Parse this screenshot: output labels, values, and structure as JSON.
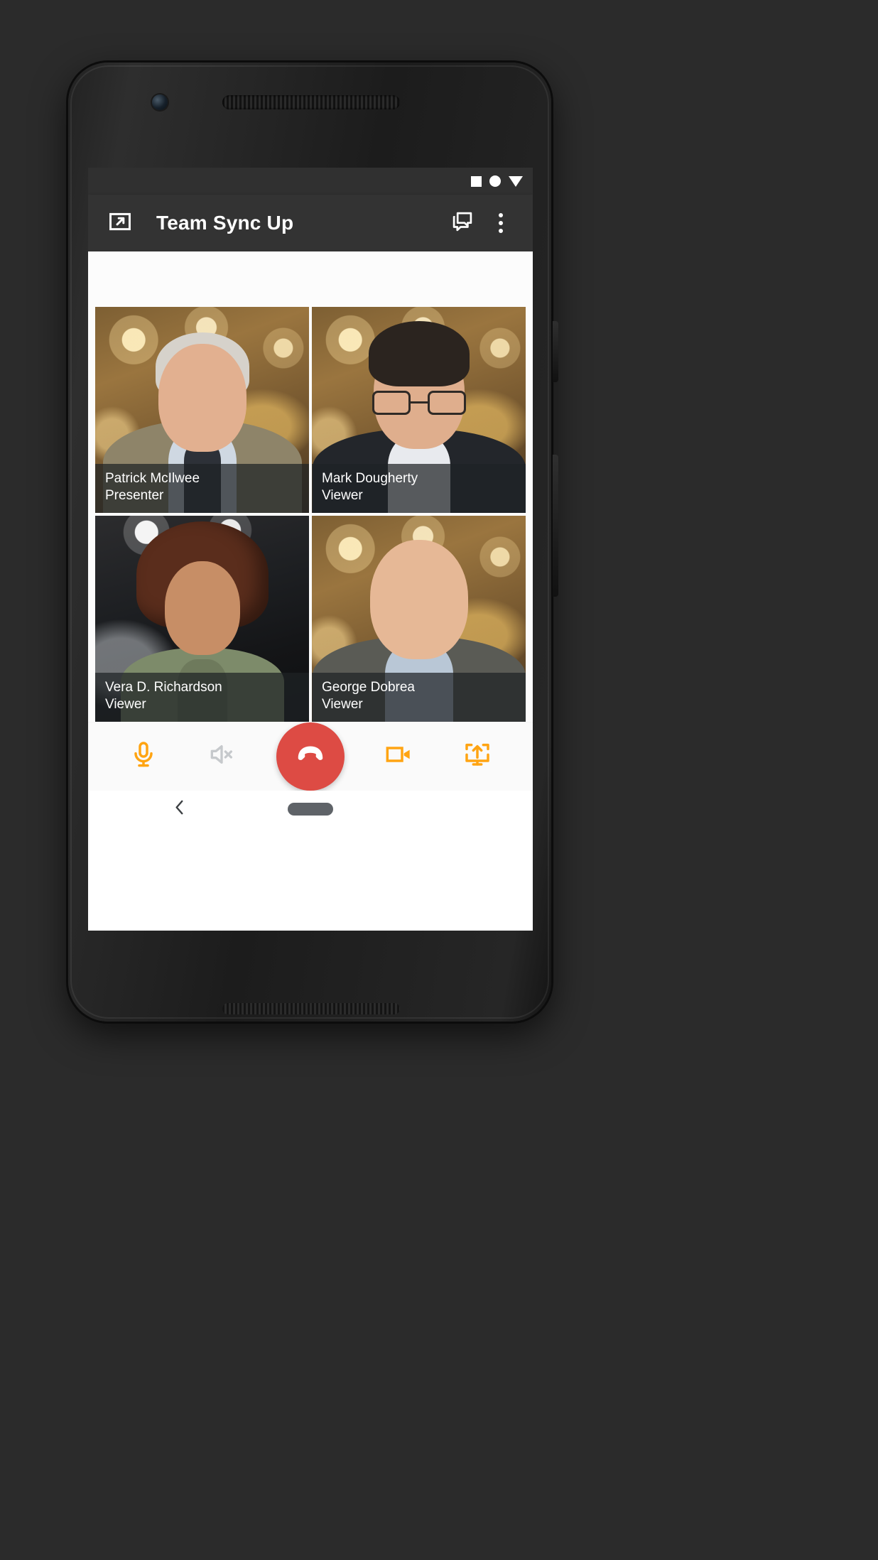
{
  "device": {
    "frame_color": "#1c1c1c",
    "screen_bg": "#ffffff"
  },
  "status_bar": {
    "background": "#303030",
    "icons": [
      "stop-square-icon",
      "record-circle-icon",
      "dropdown-triangle-icon"
    ]
  },
  "app_bar": {
    "background": "#333333",
    "title": "Team Sync Up",
    "left_icon": "present-to-screen-icon",
    "actions": [
      {
        "name": "chat-bubbles-icon",
        "label": "Chat"
      },
      {
        "name": "overflow-menu-icon",
        "label": "More options"
      }
    ]
  },
  "participants": [
    {
      "name": "Patrick McIlwee",
      "role": "Presenter",
      "scene": "lounge",
      "person_class": "p1"
    },
    {
      "name": "Mark Dougherty",
      "role": "Viewer",
      "scene": "lounge",
      "person_class": "p2"
    },
    {
      "name": "Vera D. Richardson",
      "role": "Viewer",
      "scene": "office",
      "person_class": "p3"
    },
    {
      "name": "George Dobrea",
      "role": "Viewer",
      "scene": "lounge",
      "person_class": "p4"
    }
  ],
  "call_controls": {
    "accent_color": "#FFA412",
    "inactive_color": "#c6c9cc",
    "hangup_color": "#dd4b44",
    "buttons": [
      {
        "name": "microphone-button",
        "icon": "microphone-icon",
        "label": "Mute microphone",
        "state": "active"
      },
      {
        "name": "speaker-button",
        "icon": "speaker-off-icon",
        "label": "Speaker off",
        "state": "off"
      },
      {
        "name": "end-call-button",
        "icon": "end-call-icon",
        "label": "End call",
        "state": "active"
      },
      {
        "name": "camera-button",
        "icon": "video-camera-icon",
        "label": "Camera",
        "state": "active"
      },
      {
        "name": "share-screen-button",
        "icon": "present-screen-icon",
        "label": "Share screen",
        "state": "active"
      }
    ]
  },
  "nav_bar": {
    "background": "#ffffff",
    "back_label": "Back",
    "home_label": "Home"
  }
}
